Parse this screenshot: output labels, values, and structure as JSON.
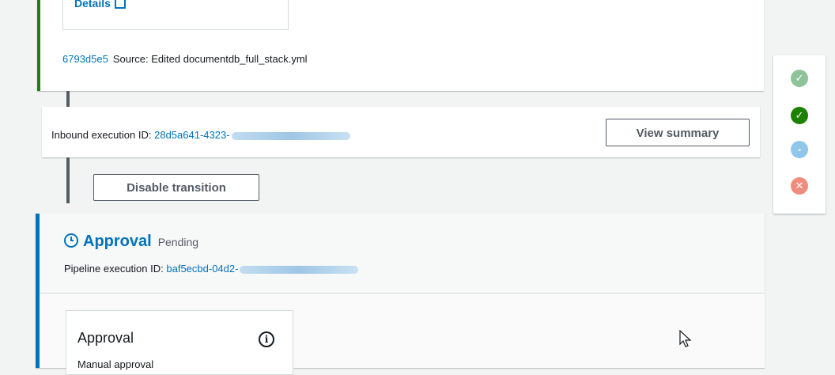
{
  "source_stage": {
    "details_label": "Details",
    "commit_id": "6793d5e5",
    "commit_message": "Source: Edited documentdb_full_stack.yml"
  },
  "transition": {
    "inbound_label": "Inbound execution ID:",
    "inbound_id": "28d5a641-4323-",
    "view_summary_label": "View summary",
    "disable_label": "Disable transition"
  },
  "approval_stage": {
    "title": "Approval",
    "status": "Pending",
    "pipeline_label": "Pipeline execution ID:",
    "pipeline_id": "baf5ecbd-04d2-",
    "action": {
      "title": "Approval",
      "subtitle": "Manual approval",
      "info_icon": "info-icon"
    }
  },
  "status_legend": [
    {
      "icon": "check-circle-icon",
      "color": "#8fc49a"
    },
    {
      "icon": "check-circle-icon",
      "color": "#1d8102"
    },
    {
      "icon": "in-progress-icon",
      "color": "#8fc7e8"
    },
    {
      "icon": "x-circle-icon",
      "color": "#f08c7e"
    }
  ]
}
